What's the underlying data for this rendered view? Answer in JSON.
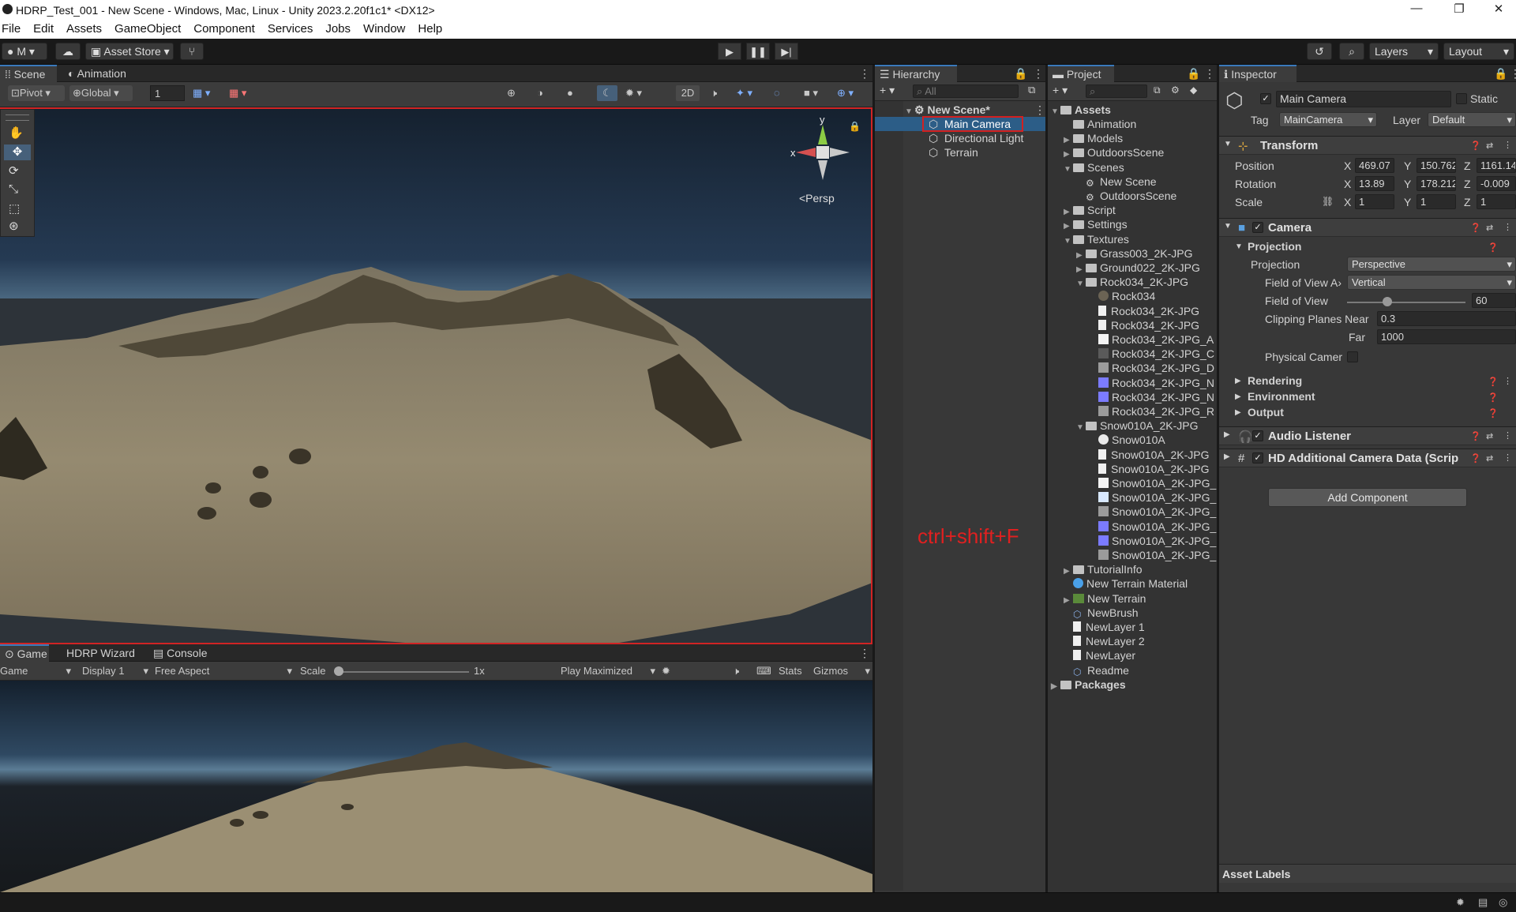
{
  "window": {
    "title": "HDRP_Test_001 - New Scene - Windows, Mac, Linux - Unity 2023.2.20f1c1* <DX12>",
    "minimize": "—",
    "maximize": "❐",
    "close": "✕"
  },
  "menu": [
    "File",
    "Edit",
    "Assets",
    "GameObject",
    "Component",
    "Services",
    "Jobs",
    "Window",
    "Help"
  ],
  "toolbar": {
    "account": "M",
    "asset_store": "Asset Store",
    "layers": "Layers",
    "layout": "Layout"
  },
  "scene_tabs": {
    "scene": "Scene",
    "animation": "Animation"
  },
  "scene_toolbar": {
    "pivot": "Pivot",
    "global": "Global",
    "grid_snap": "1",
    "mode_2d": "2D"
  },
  "scene_view": {
    "persp_label": "<Persp",
    "axis_y": "y",
    "axis_x": "x"
  },
  "game_tabs": {
    "game": "Game",
    "hdrp_wizard": "HDRP Wizard",
    "console": "Console"
  },
  "game_toolbar": {
    "view": "Game",
    "display": "Display 1",
    "aspect": "Free Aspect",
    "scale_label": "Scale",
    "scale_value": "1x",
    "play_mode": "Play Maximized",
    "stats": "Stats",
    "gizmos": "Gizmos"
  },
  "hierarchy": {
    "tab": "Hierarchy",
    "search_placeholder": "All",
    "scene": "New Scene*",
    "items": [
      "Main Camera",
      "Directional Light",
      "Terrain"
    ],
    "selected": "Main Camera"
  },
  "annotation": "ctrl+shift+F",
  "project": {
    "tab": "Project",
    "root": "Assets",
    "items": [
      {
        "label": "Animation",
        "depth": 1,
        "type": "folder",
        "fold": ""
      },
      {
        "label": "Models",
        "depth": 1,
        "type": "folder",
        "fold": "▶"
      },
      {
        "label": "OutdoorsScene",
        "depth": 1,
        "type": "folder",
        "fold": "▶"
      },
      {
        "label": "Scenes",
        "depth": 1,
        "type": "folder",
        "fold": "▼"
      },
      {
        "label": "New Scene",
        "depth": 2,
        "type": "scene",
        "fold": ""
      },
      {
        "label": "OutdoorsScene",
        "depth": 2,
        "type": "scene",
        "fold": ""
      },
      {
        "label": "Script",
        "depth": 1,
        "type": "folder",
        "fold": "▶"
      },
      {
        "label": "Settings",
        "depth": 1,
        "type": "folder",
        "fold": "▶"
      },
      {
        "label": "Textures",
        "depth": 1,
        "type": "folder",
        "fold": "▼"
      },
      {
        "label": "Grass003_2K-JPG",
        "depth": 2,
        "type": "folder",
        "fold": "▶"
      },
      {
        "label": "Ground022_2K-JPG",
        "depth": 2,
        "type": "folder",
        "fold": "▶"
      },
      {
        "label": "Rock034_2K-JPG",
        "depth": 2,
        "type": "folder",
        "fold": "▼"
      },
      {
        "label": "Rock034",
        "depth": 3,
        "type": "material",
        "fold": ""
      },
      {
        "label": "Rock034_2K-JPG",
        "depth": 3,
        "type": "file",
        "fold": ""
      },
      {
        "label": "Rock034_2K-JPG",
        "depth": 3,
        "type": "file",
        "fold": ""
      },
      {
        "label": "Rock034_2K-JPG_A",
        "depth": 3,
        "type": "tex-white",
        "fold": ""
      },
      {
        "label": "Rock034_2K-JPG_C",
        "depth": 3,
        "type": "tex-dark",
        "fold": ""
      },
      {
        "label": "Rock034_2K-JPG_D",
        "depth": 3,
        "type": "tex-gray",
        "fold": ""
      },
      {
        "label": "Rock034_2K-JPG_N",
        "depth": 3,
        "type": "tex-blue",
        "fold": ""
      },
      {
        "label": "Rock034_2K-JPG_N",
        "depth": 3,
        "type": "tex-blue",
        "fold": ""
      },
      {
        "label": "Rock034_2K-JPG_R",
        "depth": 3,
        "type": "tex-gray",
        "fold": ""
      },
      {
        "label": "Snow010A_2K-JPG",
        "depth": 2,
        "type": "folder",
        "fold": "▼"
      },
      {
        "label": "Snow010A",
        "depth": 3,
        "type": "material-white",
        "fold": ""
      },
      {
        "label": "Snow010A_2K-JPG",
        "depth": 3,
        "type": "file",
        "fold": ""
      },
      {
        "label": "Snow010A_2K-JPG",
        "depth": 3,
        "type": "file",
        "fold": ""
      },
      {
        "label": "Snow010A_2K-JPG_",
        "depth": 3,
        "type": "tex-white",
        "fold": ""
      },
      {
        "label": "Snow010A_2K-JPG_",
        "depth": 3,
        "type": "tex-lightblue",
        "fold": ""
      },
      {
        "label": "Snow010A_2K-JPG_",
        "depth": 3,
        "type": "tex-gray",
        "fold": ""
      },
      {
        "label": "Snow010A_2K-JPG_",
        "depth": 3,
        "type": "tex-blue",
        "fold": ""
      },
      {
        "label": "Snow010A_2K-JPG_",
        "depth": 3,
        "type": "tex-blue",
        "fold": ""
      },
      {
        "label": "Snow010A_2K-JPG_",
        "depth": 3,
        "type": "tex-gray",
        "fold": ""
      },
      {
        "label": "TutorialInfo",
        "depth": 1,
        "type": "folder",
        "fold": "▶"
      },
      {
        "label": "New Terrain Material",
        "depth": 1,
        "type": "material-blue",
        "fold": ""
      },
      {
        "label": "New Terrain",
        "depth": 1,
        "type": "terrain",
        "fold": "▶"
      },
      {
        "label": "NewBrush",
        "depth": 1,
        "type": "brush",
        "fold": ""
      },
      {
        "label": "NewLayer 1",
        "depth": 1,
        "type": "file",
        "fold": ""
      },
      {
        "label": "NewLayer 2",
        "depth": 1,
        "type": "file",
        "fold": ""
      },
      {
        "label": "NewLayer",
        "depth": 1,
        "type": "file",
        "fold": ""
      },
      {
        "label": "Readme",
        "depth": 1,
        "type": "brush",
        "fold": ""
      }
    ],
    "packages": "Packages"
  },
  "inspector": {
    "tab": "Inspector",
    "object_name": "Main Camera",
    "static_label": "Static",
    "tag_label": "Tag",
    "tag_value": "MainCamera",
    "layer_label": "Layer",
    "layer_value": "Default",
    "transform": {
      "title": "Transform",
      "position_label": "Position",
      "rotation_label": "Rotation",
      "scale_label": "Scale",
      "position": {
        "x": "469.07",
        "y": "150.762",
        "z": "1161.14"
      },
      "rotation": {
        "x": "13.89",
        "y": "178.212",
        "z": "-0.009"
      },
      "scale": {
        "x": "1",
        "y": "1",
        "z": "1"
      }
    },
    "camera": {
      "title": "Camera",
      "projection_section": "Projection",
      "projection_label": "Projection",
      "projection_value": "Perspective",
      "fov_axis_label": "Field of View A›",
      "fov_axis_value": "Vertical",
      "fov_label": "Field of View",
      "fov_value": "60",
      "fov_slider_fraction": 0.34,
      "clip_label": "Clipping Planes Near",
      "near_value": "0.3",
      "far_label": "Far",
      "far_value": "1000",
      "physical_label": "Physical Camer",
      "rendering": "Rendering",
      "environment": "Environment",
      "output": "Output"
    },
    "audio_listener": "Audio Listener",
    "hd_camera": "HD Additional Camera Data (Scrip",
    "add_component": "Add Component",
    "asset_labels": "Asset Labels"
  },
  "colors": {
    "accent": "#3a79bb",
    "selection": "#2c5d87",
    "highlight_box": "#d32020",
    "annotation": "#e02020"
  }
}
